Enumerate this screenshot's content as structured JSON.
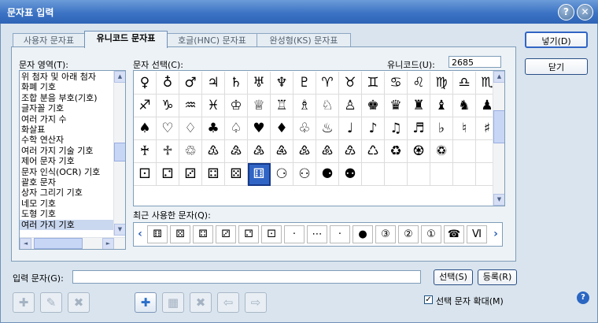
{
  "window": {
    "title": "문자표 입력",
    "help_glyph": "?",
    "close_glyph": "✕"
  },
  "tabs": [
    {
      "label": "사용자 문자표",
      "active": false
    },
    {
      "label": "유니코드 문자표",
      "active": true
    },
    {
      "label": "호글(HNC) 문자표",
      "active": false
    },
    {
      "label": "완성형(KS) 문자표",
      "active": false
    }
  ],
  "char_area": {
    "label": "문자 영역(T):",
    "items": [
      "위 첨자 및 아래 첨자",
      "화폐 기호",
      "조합 분음 부호(기호)",
      "글자꼴 기호",
      "여러 가지 수",
      "화살표",
      "수학 연산자",
      "여러 가지 기술 기호",
      "제어 문자 기호",
      "문자 인식(OCR) 기호",
      "괄호 문자",
      "상자 그리기 기호",
      "네모 기호",
      "도형 기호",
      "여러 가지 기호"
    ],
    "selected_index": 14,
    "scroll_up": "▲",
    "scroll_down": "▼",
    "scroll_left": "◄",
    "scroll_right": "►"
  },
  "char_select": {
    "label": "문자 선택(C):",
    "unicode_label": "유니코드(U):",
    "unicode_value": "2685",
    "rows": [
      [
        "♀",
        "♁",
        "♂",
        "♃",
        "♄",
        "♅",
        "♆",
        "♇",
        "♈",
        "♉",
        "♊",
        "♋",
        "♌",
        "♍",
        "♎",
        "♏"
      ],
      [
        "♐",
        "♑",
        "♒",
        "♓",
        "♔",
        "♕",
        "♖",
        "♗",
        "♘",
        "♙",
        "♚",
        "♛",
        "♜",
        "♝",
        "♞",
        "♟"
      ],
      [
        "♠",
        "♡",
        "♢",
        "♣",
        "♤",
        "♥",
        "♦",
        "♧",
        "♨",
        "♩",
        "♪",
        "♫",
        "♬",
        "♭",
        "♮",
        "♯"
      ],
      [
        "♰",
        "♱",
        "♲",
        "♳",
        "♴",
        "♵",
        "♶",
        "♷",
        "♸",
        "♹",
        "♺",
        "♻",
        "♼",
        "♽",
        "",
        ""
      ],
      [
        "⚀",
        "⚁",
        "⚂",
        "⚃",
        "⚄",
        "⚅",
        "⚆",
        "⚇",
        "⚈",
        "⚉",
        "",
        "",
        "",
        "",
        "",
        ""
      ]
    ],
    "selected": {
      "row": 4,
      "col": 5
    }
  },
  "recent": {
    "label": "최근 사용한 문자(Q):",
    "items": [
      "⚅",
      "⚄",
      "⚃",
      "⚂",
      "⚁",
      "⚀",
      "·",
      "⋯",
      "·",
      "●",
      "③",
      "②",
      "①",
      "☎",
      "Ⅵ"
    ],
    "prev": "‹",
    "next": "›"
  },
  "buttons": {
    "insert": "넣기(D)",
    "close": "닫기",
    "select": "선택(S)",
    "register": "등록(R)"
  },
  "input": {
    "label": "입력 문자(G):",
    "value": ""
  },
  "checkbox": {
    "label": "선택 문자 확대(M)",
    "checked": true,
    "mark": "✓"
  },
  "toolbar": {
    "left_icons": [
      "✚",
      "✎",
      "✖"
    ],
    "right_icons": [
      "✚",
      "▦",
      "✖",
      "⇦",
      "⇨"
    ]
  },
  "help_icon": "?"
}
